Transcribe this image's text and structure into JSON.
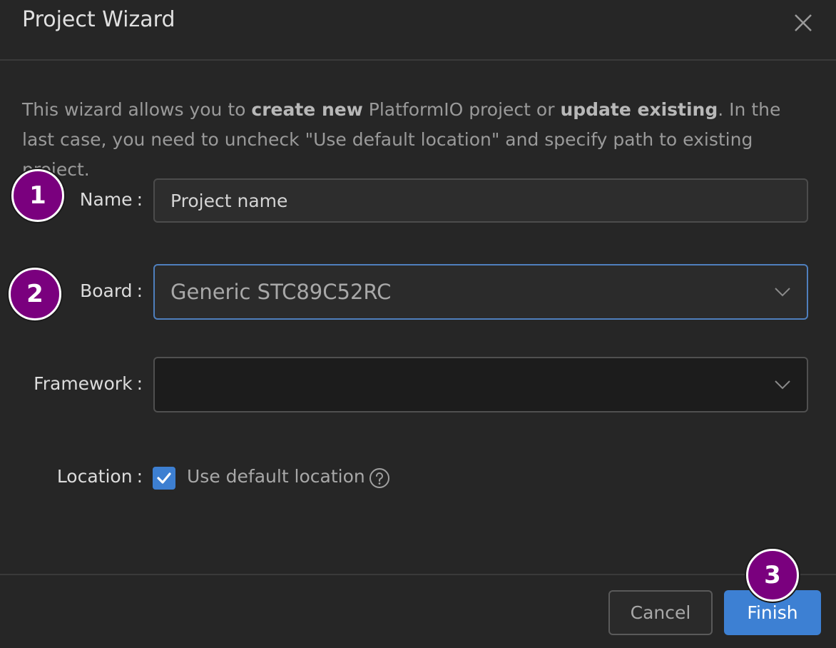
{
  "dialog": {
    "title": "Project Wizard",
    "close_icon": "close-icon"
  },
  "description": {
    "part1": "This wizard allows you to ",
    "bold1": "create new",
    "part2": " PlatformIO project or ",
    "bold2": "update existing",
    "part3": ". In the last case, you need to uncheck \"Use default location\" and specify path to existing project."
  },
  "form": {
    "name_label": "Name",
    "name_placeholder": "Project name",
    "name_value": "",
    "board_label": "Board",
    "board_value": "Generic STC89C52RC",
    "framework_label": "Framework",
    "framework_value": "",
    "location_label": "Location",
    "use_default_location_label": "Use default location",
    "use_default_location_checked": true,
    "colon": ":"
  },
  "footer": {
    "cancel_label": "Cancel",
    "finish_label": "Finish"
  },
  "markers": [
    "1",
    "2",
    "3"
  ],
  "colors": {
    "accent": "#3d80d3",
    "marker": "#7a007e",
    "background": "#262626"
  }
}
